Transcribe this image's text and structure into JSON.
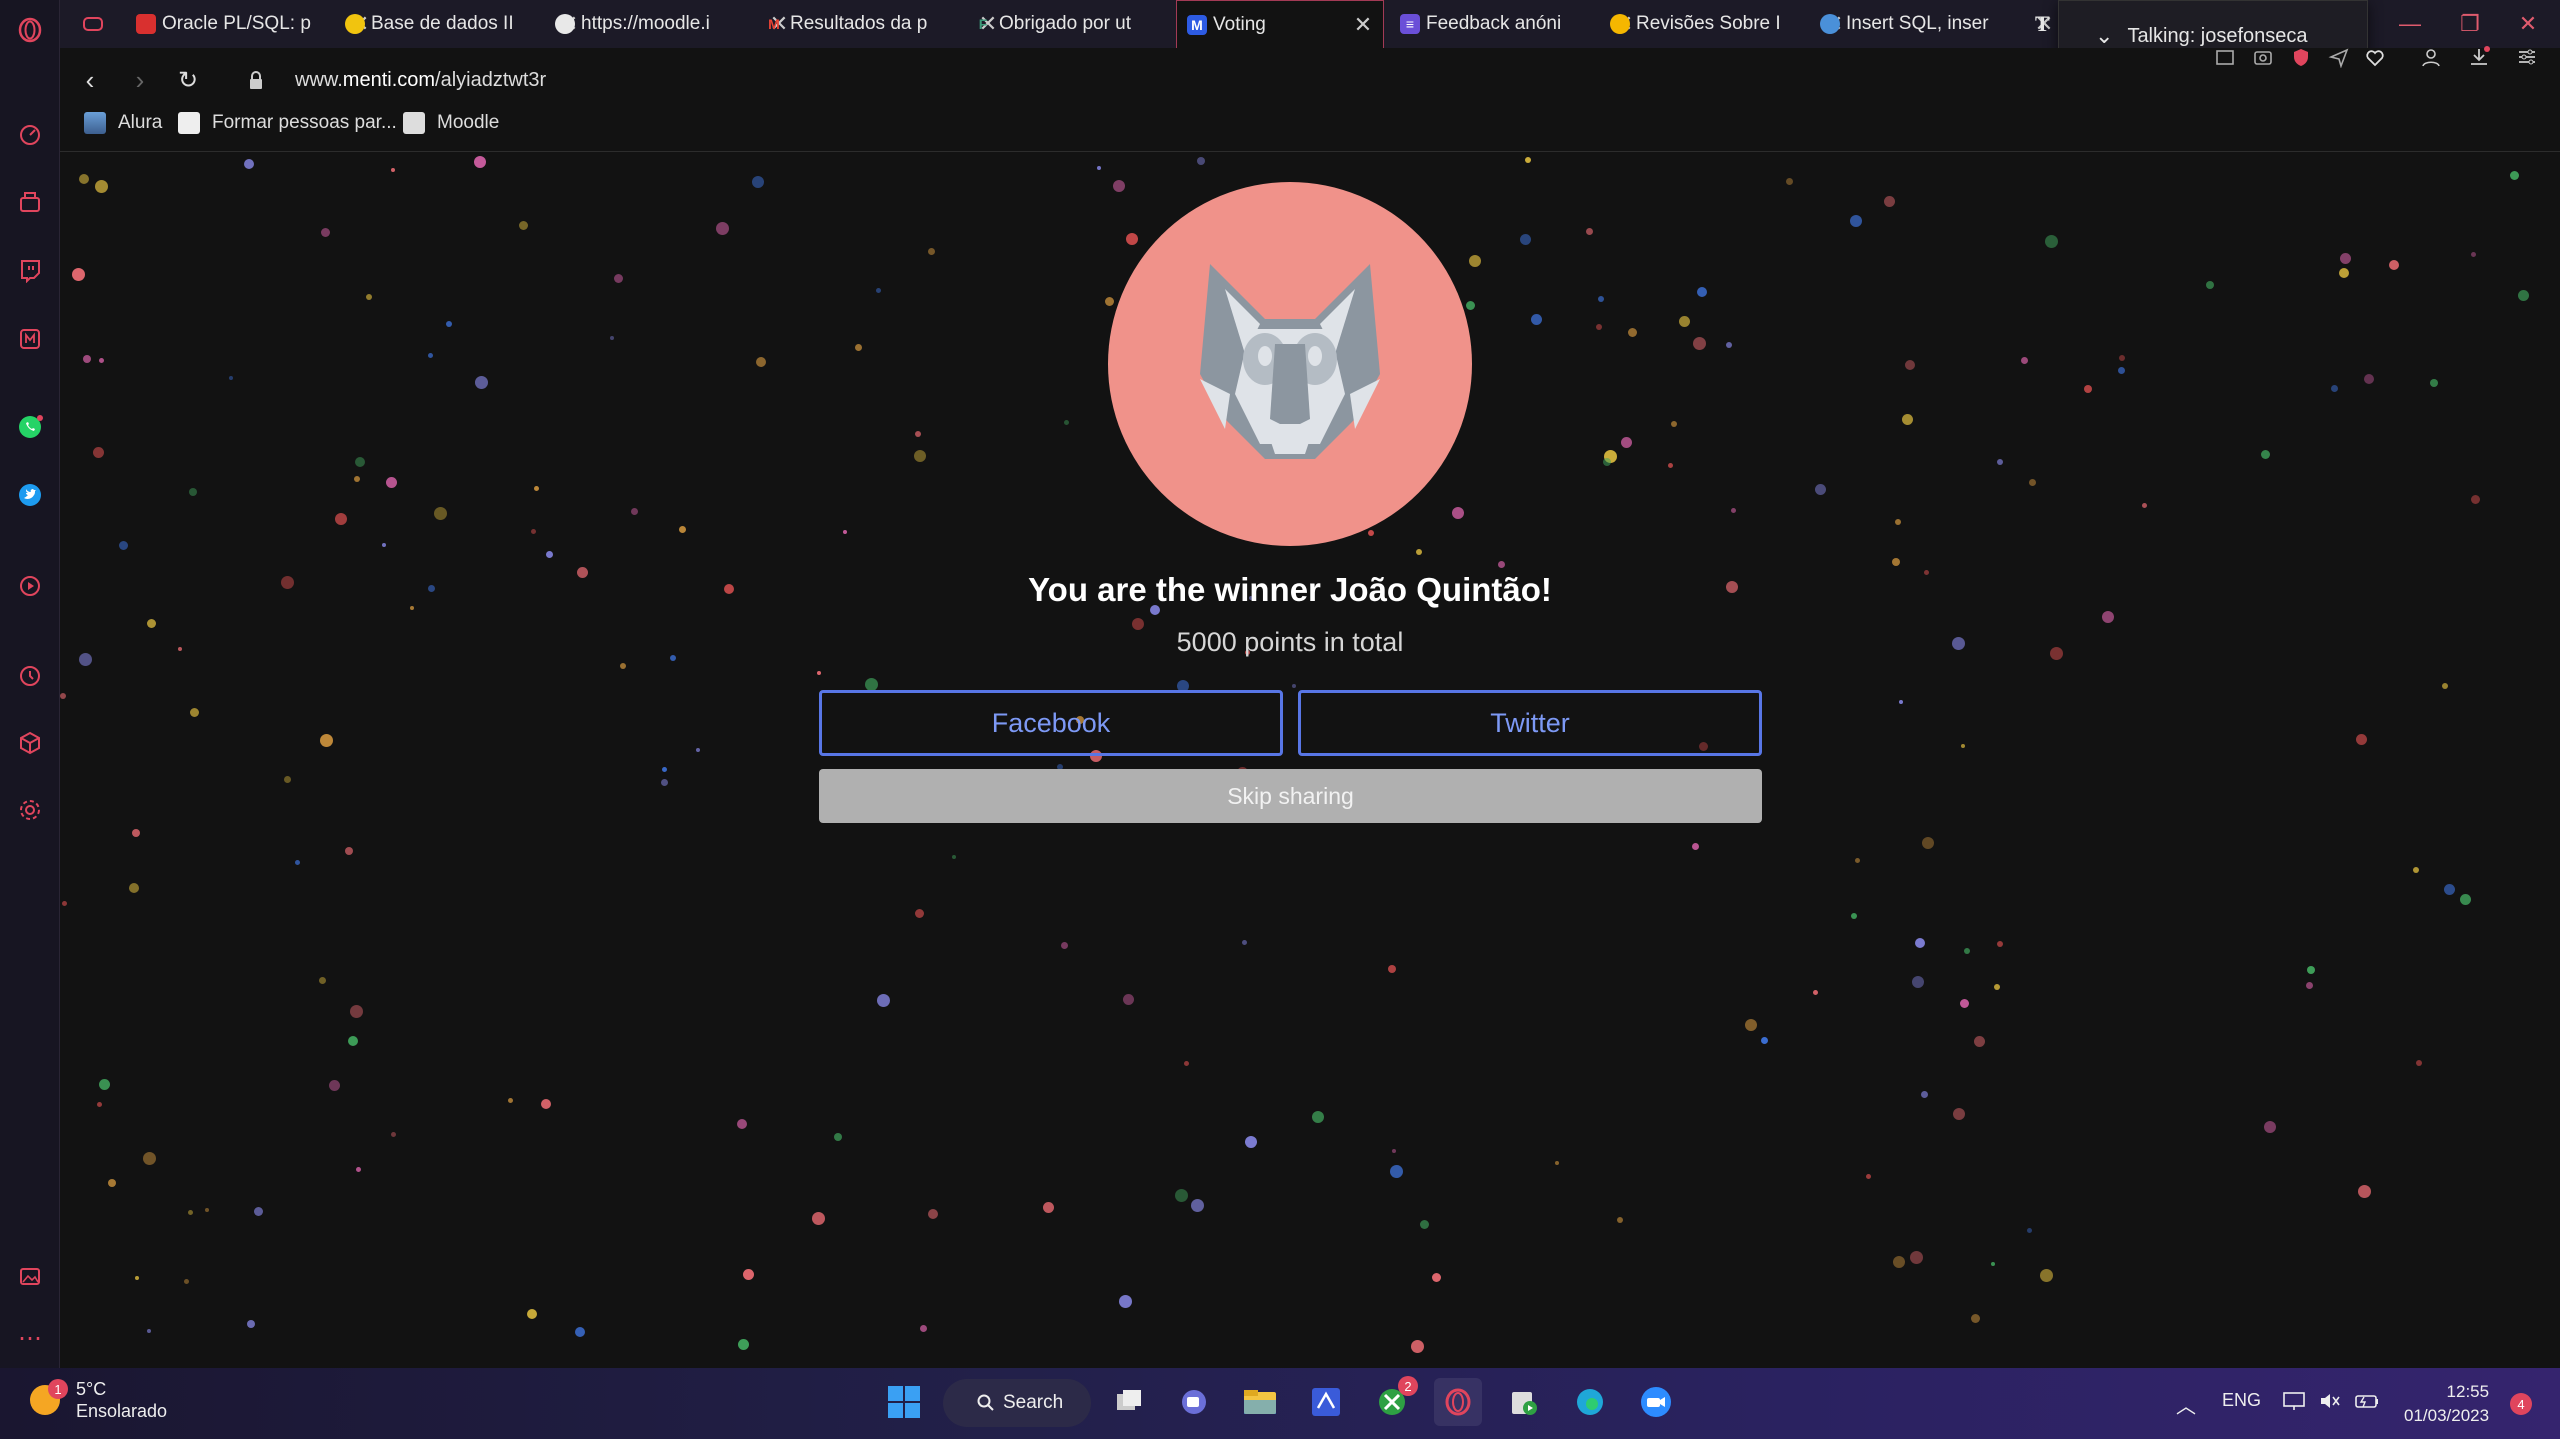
{
  "browser": {
    "tabs": [
      {
        "label": "Oracle PL/SQL: p",
        "favicon_color": "#d9302f"
      },
      {
        "label": "Base de dados II",
        "favicon_color": "#f1c40f"
      },
      {
        "label": "https://moodle.i",
        "favicon_color": "#e8e8e8"
      },
      {
        "label": "Resultados da p",
        "favicon_color": "#ea4335"
      },
      {
        "label": "Obrigado por ut",
        "favicon_color": "#3d7a66"
      },
      {
        "label": "Voting",
        "favicon_color": "#2d5be3"
      },
      {
        "label": "Feedback anóni",
        "favicon_color": "#6a4fd8"
      },
      {
        "label": "Revisões Sobre I",
        "favicon_color": "#f5b700"
      },
      {
        "label": "Insert SQL, inser",
        "favicon_color": "#4a90d9"
      },
      {
        "label": "T",
        "favicon_color": ""
      }
    ],
    "active_tab_index": 5,
    "url_prefix": "www.",
    "url_domain": "menti.com",
    "url_path": "/alyiadztwt3r",
    "bookmarks": [
      {
        "label": "Alura"
      },
      {
        "label": "Formar pessoas par..."
      },
      {
        "label": "Moodle"
      }
    ],
    "toast": "Talking: josefonseca"
  },
  "page": {
    "winner_text": "You are the winner João Quintão!",
    "points_text": "5000 points in total",
    "facebook_label": "Facebook",
    "twitter_label": "Twitter",
    "skip_label": "Skip sharing",
    "avatar_bg": "#f0928a",
    "button_accent": "#5876e6"
  },
  "taskbar": {
    "weather_temp": "5°C",
    "weather_desc": "Ensolarado",
    "weather_badge": "1",
    "search_label": "Search",
    "xbox_badge": "2",
    "lang": "ENG",
    "time": "12:55",
    "date": "01/03/2023",
    "notif_count": "4"
  }
}
